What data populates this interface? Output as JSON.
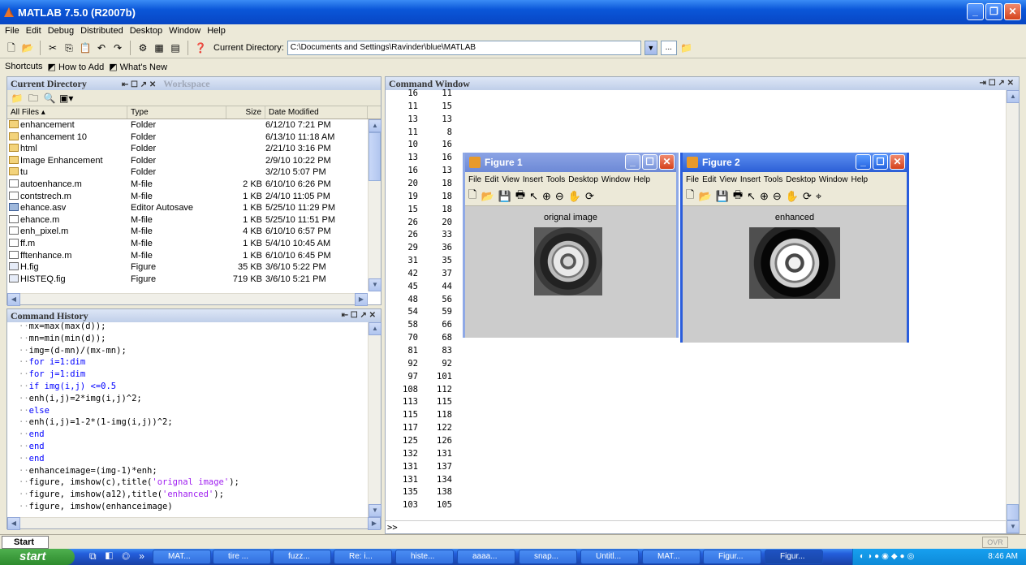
{
  "app": {
    "title": "MATLAB  7.5.0 (R2007b)",
    "menu": [
      "File",
      "Edit",
      "Debug",
      "Distributed",
      "Desktop",
      "Window",
      "Help"
    ],
    "current_directory_label": "Current Directory:",
    "current_directory": "C:\\Documents and Settings\\Ravinder\\blue\\MATLAB",
    "browse_label": "...",
    "shortcuts_label": "Shortcuts",
    "shortcut_items": [
      "How to Add",
      "What's New"
    ]
  },
  "current_directory_panel": {
    "title": "Current Directory",
    "other_tab": "Workspace",
    "columns": [
      "All Files",
      "Type",
      "Size",
      "Date Modified"
    ],
    "files": [
      {
        "name": "enhancement",
        "type": "Folder",
        "size": "",
        "date": "6/12/10 7:21 PM",
        "icon": "folder-icon"
      },
      {
        "name": "enhancement 10",
        "type": "Folder",
        "size": "",
        "date": "6/13/10 11:18 AM",
        "icon": "folder-icon"
      },
      {
        "name": "html",
        "type": "Folder",
        "size": "",
        "date": "2/21/10 3:16 PM",
        "icon": "folder-icon"
      },
      {
        "name": "Image Enhancement",
        "type": "Folder",
        "size": "",
        "date": "2/9/10 10:22 PM",
        "icon": "folder-icon"
      },
      {
        "name": "tu",
        "type": "Folder",
        "size": "",
        "date": "3/2/10 5:07 PM",
        "icon": "folder-icon"
      },
      {
        "name": "autoenhance.m",
        "type": "M-file",
        "size": "2 KB",
        "date": "6/10/10 6:26 PM",
        "icon": "m-file-icon"
      },
      {
        "name": "contstrech.m",
        "type": "M-file",
        "size": "1 KB",
        "date": "2/4/10 11:05 PM",
        "icon": "m-file-icon"
      },
      {
        "name": "ehance.asv",
        "type": "Editor Autosave",
        "size": "1 KB",
        "date": "5/25/10 11:29 PM",
        "icon": "autosave-icon"
      },
      {
        "name": "ehance.m",
        "type": "M-file",
        "size": "1 KB",
        "date": "5/25/10 11:51 PM",
        "icon": "m-file-icon"
      },
      {
        "name": "enh_pixel.m",
        "type": "M-file",
        "size": "4 KB",
        "date": "6/10/10 6:57 PM",
        "icon": "m-file-icon"
      },
      {
        "name": "ff.m",
        "type": "M-file",
        "size": "1 KB",
        "date": "5/4/10 10:45 AM",
        "icon": "m-file-icon"
      },
      {
        "name": "fftenhance.m",
        "type": "M-file",
        "size": "1 KB",
        "date": "6/10/10 6:45 PM",
        "icon": "m-file-icon"
      },
      {
        "name": "H.fig",
        "type": "Figure",
        "size": "35 KB",
        "date": "3/6/10 5:22 PM",
        "icon": "figure-file-icon"
      },
      {
        "name": "HISTEQ.fig",
        "type": "Figure",
        "size": "719 KB",
        "date": "3/6/10 5:21 PM",
        "icon": "figure-file-icon"
      }
    ]
  },
  "command_history": {
    "title": "Command History",
    "lines": [
      {
        "text": "mx=max(max(d));",
        "kind": "code"
      },
      {
        "text": "mn=min(min(d));",
        "kind": "code"
      },
      {
        "text": "img=(d-mn)/(mx-mn);",
        "kind": "code"
      },
      {
        "text": "for i=1:dim",
        "kind": "kw"
      },
      {
        "text": "for j=1:dim",
        "kind": "kw"
      },
      {
        "text": "if img(i,j) <=0.5",
        "kind": "kw"
      },
      {
        "text": "enh(i,j)=2*img(i,j)^2;",
        "kind": "code"
      },
      {
        "text": "else",
        "kind": "kw"
      },
      {
        "text": "enh(i,j)=1-2*(1-img(i,j))^2;",
        "kind": "code"
      },
      {
        "text": "end",
        "kind": "kw"
      },
      {
        "text": "end",
        "kind": "kw"
      },
      {
        "text": "end",
        "kind": "kw"
      },
      {
        "text": "enhanceimage=(img-1)*enh;",
        "kind": "code"
      },
      {
        "pre": "figure, imshow(c),title(",
        "str": "'orignal image'",
        "post": ");",
        "kind": "mixed"
      },
      {
        "pre": "figure, imshow(a12),title(",
        "str": "'enhanced'",
        "post": ");",
        "kind": "mixed"
      },
      {
        "text": "figure, imshow(enhanceimage)",
        "kind": "code"
      }
    ]
  },
  "command_window": {
    "title": "Command Window",
    "rows": [
      [
        "16",
        "11"
      ],
      [
        "11",
        "15"
      ],
      [
        "13",
        "13"
      ],
      [
        "11",
        "8"
      ],
      [
        "10",
        "16"
      ],
      [
        "13",
        "16"
      ],
      [
        "16",
        "13"
      ],
      [
        "20",
        "18"
      ],
      [
        "19",
        "18"
      ],
      [
        "15",
        "18"
      ],
      [
        "26",
        "20"
      ],
      [
        "26",
        "33"
      ],
      [
        "29",
        "36"
      ],
      [
        "31",
        "35"
      ],
      [
        "42",
        "37"
      ],
      [
        "45",
        "44"
      ],
      [
        "48",
        "56"
      ],
      [
        "54",
        "59"
      ],
      [
        "58",
        "66"
      ],
      [
        "70",
        "68"
      ],
      [
        "81",
        "83"
      ],
      [
        "92",
        "92"
      ],
      [
        "97",
        "101"
      ],
      [
        "108",
        "112"
      ],
      [
        "113",
        "115"
      ],
      [
        "115",
        "118"
      ],
      [
        "117",
        "122"
      ],
      [
        "125",
        "126"
      ],
      [
        "132",
        "131"
      ],
      [
        "131",
        "137"
      ],
      [
        "131",
        "134"
      ],
      [
        "135",
        "138"
      ],
      [
        "103",
        "105"
      ]
    ],
    "prompt": ">>"
  },
  "figure1": {
    "title": "Figure 1",
    "menu": [
      "File",
      "Edit",
      "View",
      "Insert",
      "Tools",
      "Desktop",
      "Window",
      "Help"
    ],
    "caption": "orignal image"
  },
  "figure2": {
    "title": "Figure 2",
    "menu": [
      "File",
      "Edit",
      "View",
      "Insert",
      "Tools",
      "Desktop",
      "Window",
      "Help"
    ],
    "caption": "enhanced"
  },
  "status": {
    "start_label": "Start",
    "ovr": "OVR"
  },
  "taskbar": {
    "start": "start",
    "tasks": [
      "MAT...",
      "tire ...",
      "fuzz...",
      "Re: i...",
      "histe...",
      "aaaa...",
      "snap...",
      "Untitl...",
      "MAT...",
      "Figur...",
      "Figur..."
    ],
    "clock": "8:46 AM"
  },
  "colors": {
    "xp_blue": "#0a56d8",
    "keyword": "#0000ff",
    "string": "#a020f0",
    "figure_bg": "#cccccc"
  }
}
